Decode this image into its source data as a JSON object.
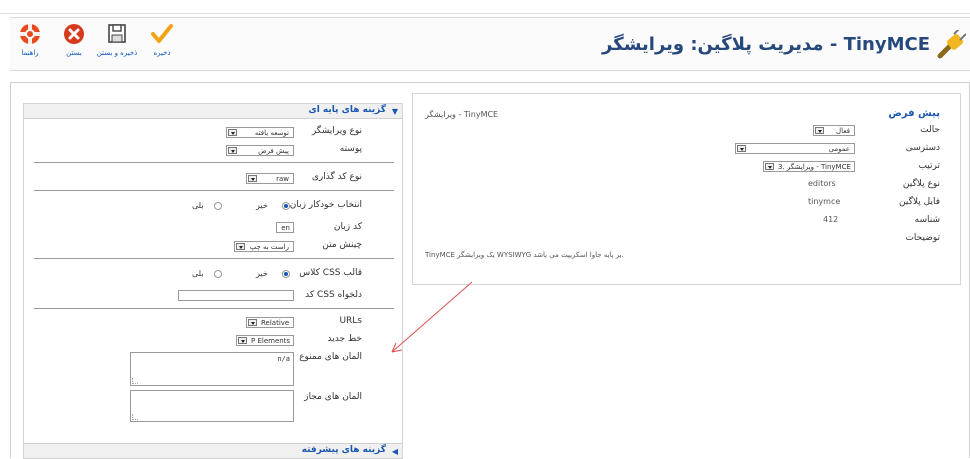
{
  "page": {
    "title": "مدیریت پلاگین: ویرایشگر - TinyMCE"
  },
  "toolbar": {
    "help": "راهنما",
    "close": "بستن",
    "save_close": "ذخیره و بستن",
    "save": "ذخیره"
  },
  "details": {
    "legend": "پیش فرض",
    "name_value": "ویرایشگر - TinyMCE",
    "fields": [
      {
        "label": "حالت",
        "value": "فعال"
      },
      {
        "label": "دسترسی",
        "value": "عمومی"
      },
      {
        "label": "ترتیب",
        "value": "3. ویرایشگر - TinyMCE"
      },
      {
        "label": "نوع پلاگین",
        "value": "editors"
      },
      {
        "label": "فایل پلاگین",
        "value": "tinymce"
      },
      {
        "label": "شناسه",
        "value": "412"
      },
      {
        "label": "توضیحات",
        "value": ""
      }
    ],
    "description": "TinyMCE یک ویرایشگر WYSIWYG بر پایه جاوا اسکریپت می باشد."
  },
  "basic": {
    "header": "گزینه های پایه ای",
    "editor_mode_label": "نوع ویرایشگر",
    "editor_mode_value": "توسعه یافته",
    "skin_label": "پوسته",
    "skin_value": "پیش فرض",
    "encoding_label": "نوع کد گذاری",
    "encoding_value": "raw",
    "autolang_label": "انتخاب خودکار زبان",
    "yes": "بلی",
    "no": "خیر",
    "lang_code_label": "کد زبان",
    "lang_code_value": "en",
    "direction_label": "چینش متن",
    "direction_value": "راست به چپ",
    "css_label": "کلاس CSS قالب",
    "custom_css_label": "کد CSS دلخواه",
    "custom_css_value": "",
    "urls_label": "URLs",
    "urls_value": "Relative",
    "newline_label": "خط جدید",
    "newline_value": "P Elements",
    "prohibited_label": "المان های ممنوع",
    "prohibited_value": "n/a",
    "allowed_label": "المان های مجاز",
    "allowed_value": ""
  },
  "advanced": {
    "header": "گزینه های پیشرفته"
  },
  "colors": {
    "title": "#26487c",
    "link": "#1b57b1",
    "annotation_arrow": "#e05050"
  }
}
